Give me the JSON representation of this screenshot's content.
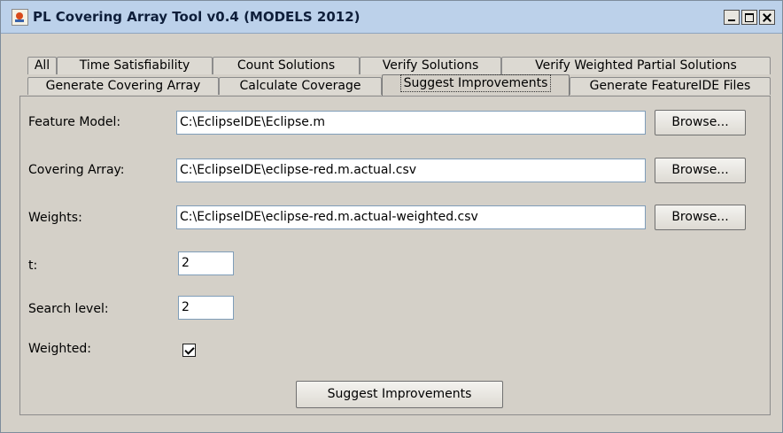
{
  "window": {
    "title": "PL Covering Array Tool v0.4 (MODELS 2012)",
    "icon": "java-icon"
  },
  "tabs": {
    "row1": [
      "All",
      "Time Satisfiability",
      "Count Solutions",
      "Verify Solutions",
      "Verify Weighted Partial Solutions"
    ],
    "row2": [
      "Generate Covering Array",
      "Calculate Coverage",
      "Suggest Improvements",
      "Generate FeatureIDE Files"
    ],
    "selected": "Suggest Improvements"
  },
  "form": {
    "feature_model": {
      "label": "Feature Model:",
      "value": "C:\\EclipseIDE\\Eclipse.m",
      "button": "Browse..."
    },
    "covering_array": {
      "label": "Covering Array:",
      "value": "C:\\EclipseIDE\\eclipse-red.m.actual.csv",
      "button": "Browse..."
    },
    "weights": {
      "label": "Weights:",
      "value": "C:\\EclipseIDE\\eclipse-red.m.actual-weighted.csv",
      "button": "Browse..."
    },
    "t": {
      "label": "t:",
      "value": "2"
    },
    "search_level": {
      "label": "Search level:",
      "value": "2"
    },
    "weighted": {
      "label": "Weighted:",
      "checked": true
    },
    "submit_label": "Suggest Improvements"
  }
}
